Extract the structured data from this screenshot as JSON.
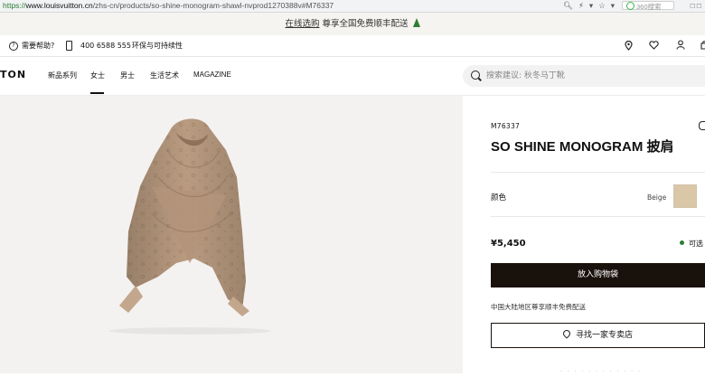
{
  "browser": {
    "url_proto": "https://",
    "url_host": "www.louisvuitton.cn",
    "url_path": "/zhs-cn/products/so-shine-monogram-shawl-nvprod1270388v#M76337",
    "search_placeholder": "360搜索"
  },
  "promo": {
    "link": "在线选购",
    "text": "尊享全国免费顺丰配送"
  },
  "utility": {
    "help": "需要帮助?",
    "phone": "400 6588 555",
    "sustainability": "环保与可持续性"
  },
  "nav": {
    "logo": "TON",
    "items": [
      "新品系列",
      "女士",
      "男士",
      "生活艺术",
      "MAGAZINE"
    ],
    "search_placeholder": "搜索建议: 秋冬马丁靴"
  },
  "product": {
    "sku": "M76337",
    "title": "SO SHINE MONOGRAM 披肩",
    "color_label": "颜色",
    "color_value": "Beige",
    "swatch_color": "#d9c7a7",
    "price": "¥5,450",
    "availability": "可选",
    "add_to_cart": "放入购物袋",
    "shipping_note": "中国大陆地区尊享顺丰免费配送",
    "find_store": "寻找一家专卖店"
  }
}
